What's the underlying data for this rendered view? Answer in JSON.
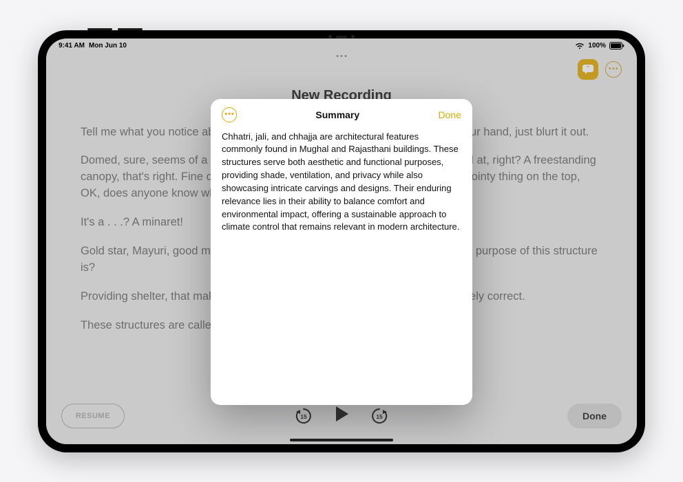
{
  "status": {
    "time": "9:41 AM",
    "date": "Mon Jun 10",
    "battery": "100%"
  },
  "header": {
    "title": "New Recording"
  },
  "transcript": {
    "paragraphs": [
      "Tell me what you notice about this next building. Anyone? No need to raise your hand, just blurt it out.",
      "Domed, sure, seems of a piece with the Mughal architecture that we've looked at, right? A freestanding canopy, that's right. Fine carvings, for sure, a whole system of fine carvings. Pointy thing on the top, OK, does anyone know what the pointy thing is called?",
      "It's a . . .? A minaret!",
      "Gold star, Mayuri, good memory. And what would you, any of you, imagine the purpose of this structure is?",
      "Providing shelter, that makes sense. Specifically shade. Yes? You are absolutely correct.",
      "These structures are called chhajja."
    ]
  },
  "controls": {
    "resume": "RESUME",
    "done": "Done",
    "skip_back_seconds": "15",
    "skip_fwd_seconds": "15"
  },
  "popover": {
    "title": "Summary",
    "done": "Done",
    "body": "Chhatri, jali, and chhajja are architectural features commonly found in Mughal and Rajasthani buildings. These structures serve both aesthetic and functional purposes, providing shade, ventilation, and privacy while also showcasing intricate carvings and designs. Their enduring relevance lies in their ability to balance comfort and environmental impact, offering a sustainable approach to climate control that remains relevant in modern architecture."
  }
}
